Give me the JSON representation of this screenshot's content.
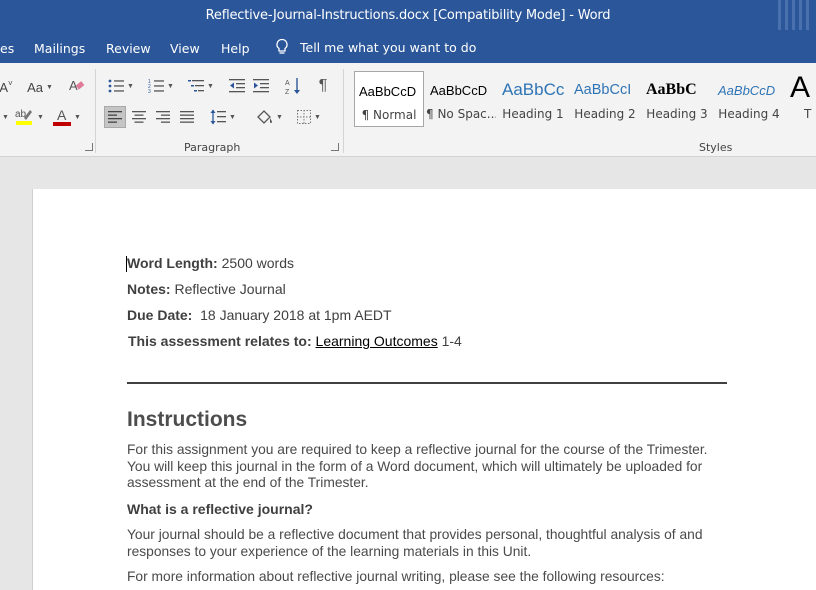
{
  "window": {
    "title": "Reflective-Journal-Instructions.docx [Compatibility Mode]  -  Word"
  },
  "tabs": [
    {
      "label": "es"
    },
    {
      "label": "Mailings"
    },
    {
      "label": "Review"
    },
    {
      "label": "View"
    },
    {
      "label": "Help"
    }
  ],
  "tell_me": {
    "label": "Tell me what you want to do",
    "icon": "lightbulb-icon"
  },
  "ribbon": {
    "font_group": {
      "change_case": "Aa",
      "grow_font_partial": "A",
      "clear_formatting_icon": "eraser-icon",
      "highlight_icon": "highlighter-icon",
      "font_color_letter": "A",
      "font_color": "#c00000",
      "highlight_color": "#ffff00"
    },
    "paragraph_group": {
      "label": "Paragraph"
    },
    "styles_group": {
      "label": "Styles",
      "items": [
        {
          "preview": "AaBbCcD",
          "name": "¶ Normal",
          "selected": true
        },
        {
          "preview": "AaBbCcD",
          "name": "¶ No Spac..."
        },
        {
          "preview": "AaBbCc",
          "name": "Heading 1"
        },
        {
          "preview": "AaBbCcI",
          "name": "Heading 2"
        },
        {
          "preview": "AaBbC",
          "name": "Heading 3"
        },
        {
          "preview": "AaBbCcD",
          "name": "Heading 4"
        },
        {
          "preview": "A",
          "name": "T"
        }
      ]
    }
  },
  "document": {
    "meta": [
      {
        "label": "Word Length:",
        "value": " 2500 words"
      },
      {
        "label": "Notes:",
        "value": " Reflective Journal"
      },
      {
        "label": "Due Date:",
        "value": "  18 January 2018 at 1pm AEDT"
      }
    ],
    "assessment": {
      "label": "This assessment relates to:",
      "link": "Learning Outcomes",
      "suffix": " 1-4"
    },
    "heading": "Instructions",
    "para1": "For this assignment you are required to keep a reflective journal for the course of the Trimester. You will keep this journal in the form of a Word document, which will ultimately be uploaded for assessment at the end of the Trimester.",
    "subheading": "What is a reflective journal?",
    "para2": "Your journal should be a reflective document that provides personal, thoughtful analysis of and responses to your experience of the learning materials in this Unit.",
    "para3": "For more information about reflective journal writing, please see the following resources:"
  }
}
